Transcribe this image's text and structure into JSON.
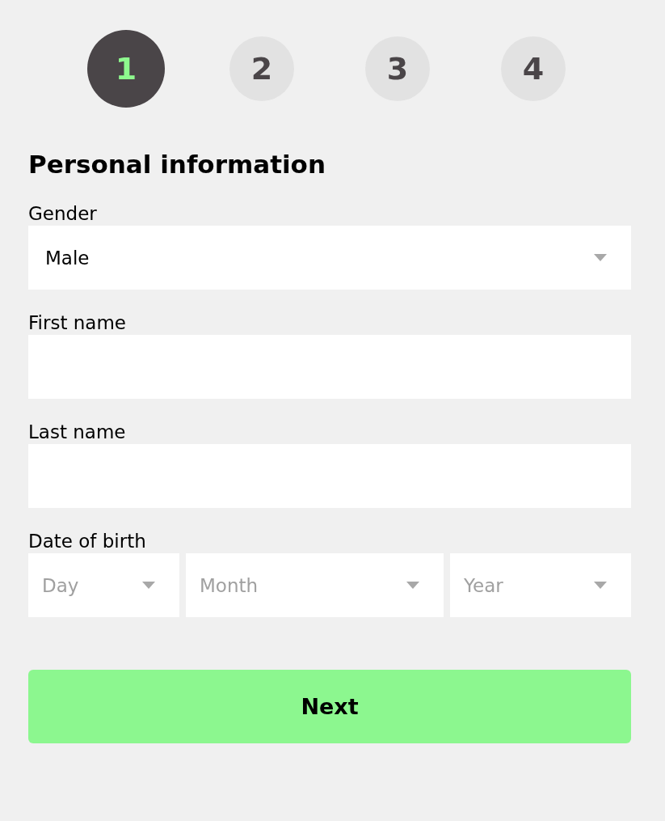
{
  "steps": [
    {
      "label": "1",
      "selected": true
    },
    {
      "label": "2",
      "selected": false
    },
    {
      "label": "3",
      "selected": false
    },
    {
      "label": "4",
      "selected": false
    }
  ],
  "heading": "Personal information",
  "fields": [
    {
      "kind": "select",
      "label": "Gender",
      "value": "Male"
    },
    {
      "kind": "text",
      "label": "First name"
    },
    {
      "kind": "text",
      "label": "Last name"
    },
    {
      "kind": "date",
      "label": "Date of birth",
      "parts": [
        {
          "placeholder": "Day"
        },
        {
          "placeholder": "Month"
        },
        {
          "placeholder": "Year"
        }
      ]
    }
  ],
  "button": "Next"
}
